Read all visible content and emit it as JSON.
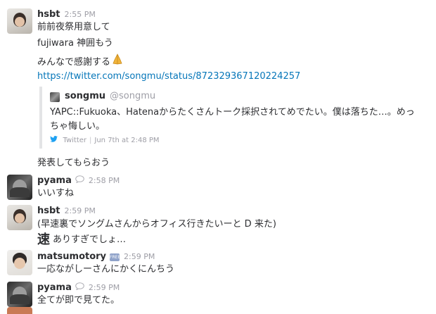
{
  "messages": [
    {
      "user": "hsbt",
      "time": "2:55 PM",
      "lines": [
        "前前夜祭用意して",
        "fujiwara 神囲もう",
        "みんなで感謝する"
      ],
      "link": "https://twitter.com/songmu/status/872329367120224257",
      "attachment": {
        "author_name": "songmu",
        "author_handle": "@songmu",
        "text": "YAPC::Fukuoka、Hatenaからたくさんトーク採択されてめでたい。僕は落ちた…。めっちゃ悔しい。",
        "source": "Twitter",
        "date": "Jun 7th at 2:48 PM"
      },
      "after": "発表してもらおう"
    },
    {
      "user": "pyama",
      "time": "2:58 PM",
      "text": "いいすね"
    },
    {
      "user": "hsbt",
      "time": "2:59 PM",
      "text": "(早速裏でソングムさんからオフィス行きたいーと D 来た)",
      "emoji_glyph": "速",
      "text2": "ありすぎでしょ…"
    },
    {
      "user": "matsumotory",
      "time": "2:59 PM",
      "badge": "FREE",
      "text": "一応ながしーさんにかくにんちう"
    },
    {
      "user": "pyama",
      "time": "2:59 PM",
      "text": "全てが即で見てた。"
    }
  ],
  "icons": {
    "pray": "pray-emoji",
    "status": "speech-bubble-icon",
    "twitter": "twitter-bird-icon"
  },
  "colors": {
    "link": "#0576b9",
    "twitter": "#1da1f2"
  }
}
